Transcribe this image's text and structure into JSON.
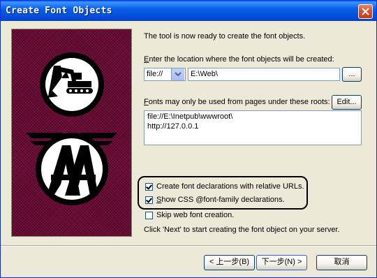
{
  "window": {
    "title": "Create Font Objects"
  },
  "intro": "The tool is now ready to create the font objects.",
  "location": {
    "label_key": "E",
    "label_rest": "nter the location where the font objects will be created:",
    "protocol": "file://",
    "path": "E:\\Web\\",
    "browse_label": "..."
  },
  "roots": {
    "label_key": "F",
    "label_rest": "onts may only be used from pages under these roots:",
    "edit_label": "Edit...",
    "items": [
      "file://E:\\Inetpub\\wwwroot\\",
      "http://127.0.0.1"
    ]
  },
  "options": [
    {
      "label": "Create font declarations with relative URLs.",
      "checked": true
    },
    {
      "label_key": "S",
      "label_rest": "how CSS @font-family declarations.",
      "checked": true
    },
    {
      "label": "Skip web font creation.",
      "checked": false
    }
  ],
  "hint": "Click 'Next' to start creating the font object on your server.",
  "buttons": {
    "back": "< 上一步(B)",
    "next": "下一步(N) >",
    "cancel": "取消"
  },
  "banner_logo": "AA",
  "colors": {
    "titlebar": "#0a5fe8",
    "banner": "#7a1240",
    "face": "#ece9d8"
  }
}
